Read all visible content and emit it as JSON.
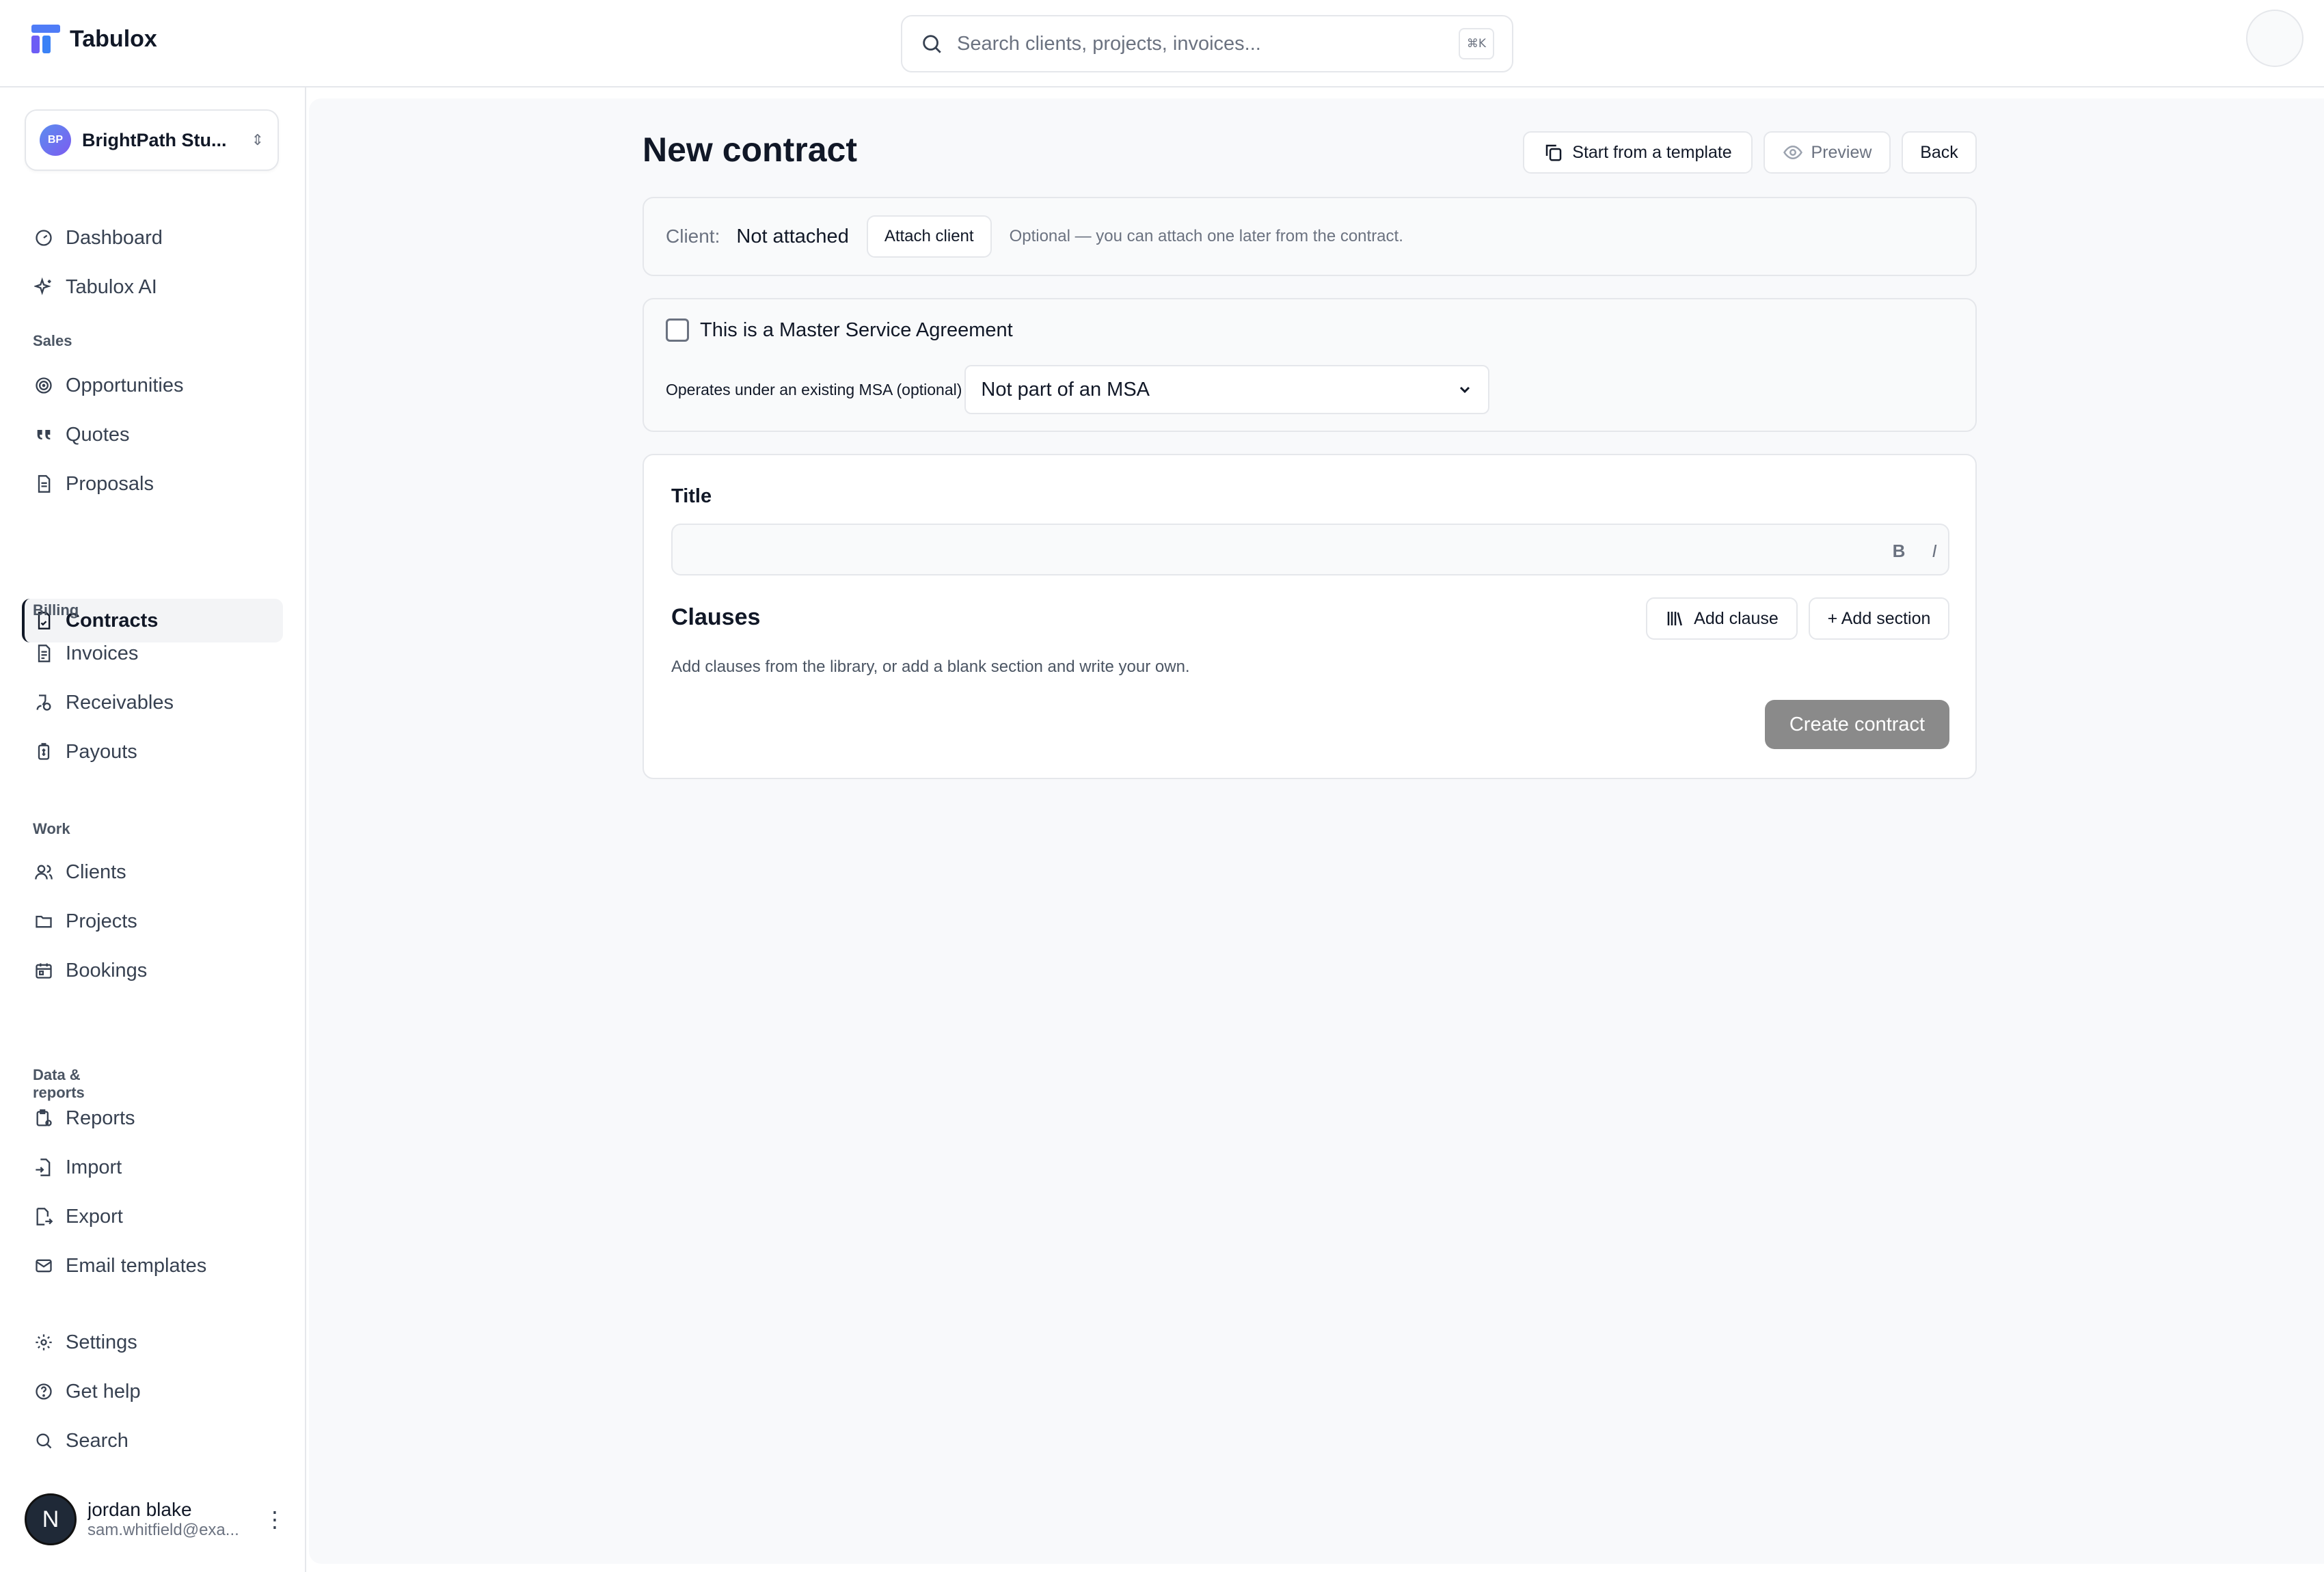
{
  "app": {
    "name": "Tabulox"
  },
  "search": {
    "placeholder": "Search clients, projects, invoices...",
    "shortcut": "⌘K"
  },
  "workspace": {
    "initials": "BP",
    "name": "BrightPath Stu..."
  },
  "sidebar": {
    "top": [
      {
        "label": "Dashboard",
        "icon": "dashboard-icon"
      },
      {
        "label": "Tabulox AI",
        "icon": "sparkles-icon"
      }
    ],
    "sections": [
      {
        "title": "Sales",
        "items": [
          {
            "label": "Opportunities",
            "icon": "target-icon"
          },
          {
            "label": "Quotes",
            "icon": "quote-icon"
          },
          {
            "label": "Proposals",
            "icon": "document-icon"
          },
          {
            "label": "Contracts",
            "icon": "contract-icon",
            "active": true
          }
        ]
      },
      {
        "title": "Billing",
        "items": [
          {
            "label": "Invoices",
            "icon": "invoice-icon"
          },
          {
            "label": "Receivables",
            "icon": "receivables-icon"
          },
          {
            "label": "Payouts",
            "icon": "payouts-icon"
          }
        ]
      },
      {
        "title": "Work",
        "items": [
          {
            "label": "Clients",
            "icon": "users-icon"
          },
          {
            "label": "Projects",
            "icon": "folder-icon"
          },
          {
            "label": "Bookings",
            "icon": "calendar-icon"
          }
        ]
      },
      {
        "title": "Data & reports",
        "items": [
          {
            "label": "Reports",
            "icon": "reports-icon"
          },
          {
            "label": "Import",
            "icon": "import-icon"
          },
          {
            "label": "Export",
            "icon": "export-icon"
          },
          {
            "label": "Email templates",
            "icon": "mail-icon"
          }
        ]
      }
    ],
    "bottom": [
      {
        "label": "Settings",
        "icon": "gear-icon"
      },
      {
        "label": "Get help",
        "icon": "help-icon"
      },
      {
        "label": "Search",
        "icon": "search-icon"
      }
    ]
  },
  "user": {
    "initial": "N",
    "name": "jordan blake",
    "email": "sam.whitfield@exa..."
  },
  "page": {
    "title": "New contract",
    "actions": {
      "template": "Start from a template",
      "preview": "Preview",
      "back": "Back"
    }
  },
  "client": {
    "label": "Client:",
    "value": "Not attached",
    "attach": "Attach client",
    "note": "Optional — you can attach one later from the contract."
  },
  "msa": {
    "checkbox_label": "This is a Master Service Agreement",
    "checked": false,
    "existing_label": "Operates under an existing MSA (optional)",
    "selected": "Not part of an MSA"
  },
  "form": {
    "title_label": "Title",
    "title_value": "",
    "bold": "B",
    "italic": "I",
    "clauses_heading": "Clauses",
    "add_clause": "Add clause",
    "add_section": "+ Add section",
    "clauses_note": "Add clauses from the library, or add a blank section and write your own.",
    "create": "Create contract"
  }
}
